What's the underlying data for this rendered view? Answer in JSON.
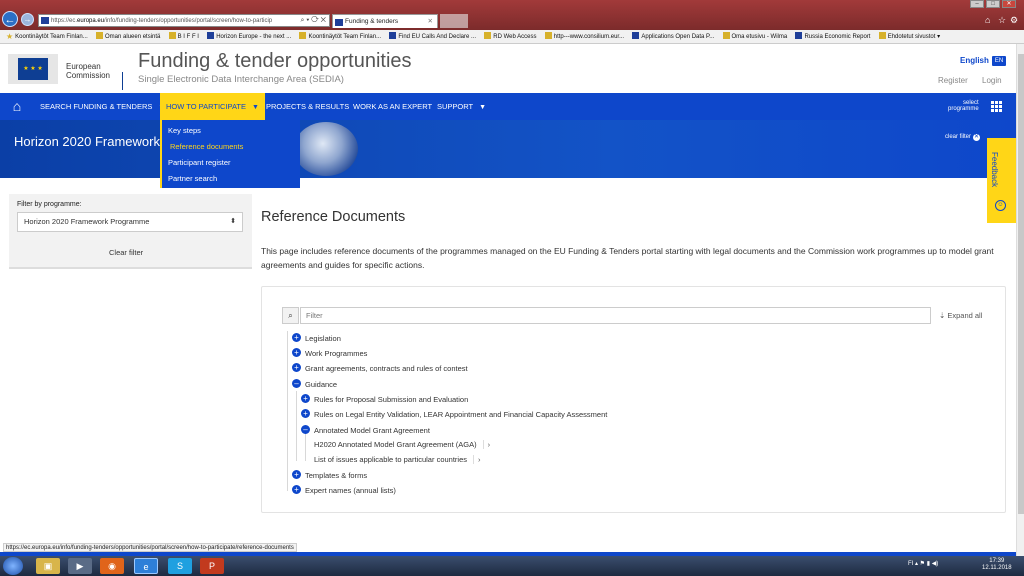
{
  "browser": {
    "url_prefix": "https://ec.",
    "url_domain": "europa.eu",
    "url_path": "/info/funding-tenders/opportunities/portal/screen/how-to-particip",
    "url_controls": "⌕ ▾ ⟳ ✕",
    "tab_title": "Funding & tenders",
    "tab_close": "✕",
    "back_icon": "back-arrow-icon",
    "forward_icon": "forward-arrow-icon",
    "window_controls": [
      "–",
      "□",
      "✕"
    ],
    "chrome_icons": [
      "⌂",
      "☆",
      "⚙",
      "☺"
    ]
  },
  "bookmarks": [
    {
      "label": "Koontinäytöt Team Finlan...",
      "icon": "folder"
    },
    {
      "label": "Oman alueen etsintä",
      "icon": "page"
    },
    {
      "label": "B I F F I",
      "icon": "page"
    },
    {
      "label": "Horizon Europe - the next ...",
      "icon": "eu"
    },
    {
      "label": "Koontinäytöt Team Finlan...",
      "icon": "folder"
    },
    {
      "label": "Find EU Calls And Declare ...",
      "icon": "eu"
    },
    {
      "label": "RD Web Access",
      "icon": "page"
    },
    {
      "label": "http---www.consilium.eur...",
      "icon": "page"
    },
    {
      "label": "Applications  Open Data P...",
      "icon": "page"
    },
    {
      "label": "Oma etusivu - Wilma",
      "icon": "page"
    },
    {
      "label": "Russia Economic Report",
      "icon": "page"
    },
    {
      "label": "Ehdotetut sivustot ▾",
      "icon": "page"
    }
  ],
  "header": {
    "logo_line1": "European",
    "logo_line2": "Commission",
    "title": "Funding & tender opportunities",
    "subtitle": "Single Electronic Data Interchange Area (SEDIA)",
    "language": "English",
    "language_code": "EN",
    "register": "Register",
    "login": "Login"
  },
  "nav": {
    "items": [
      {
        "label": "SEARCH FUNDING & TENDERS",
        "has_caret": true
      },
      {
        "label": "HOW TO PARTICIPATE",
        "has_caret": true,
        "active": true
      },
      {
        "label": "PROJECTS & RESULTS",
        "has_caret": false
      },
      {
        "label": "WORK AS AN EXPERT",
        "has_caret": false
      },
      {
        "label": "SUPPORT",
        "has_caret": true
      }
    ],
    "select_programme_line1": "select",
    "select_programme_line2": "programme",
    "caret": "▼"
  },
  "dropdown": {
    "items": [
      "Key steps",
      "Reference documents",
      "Participant register",
      "Partner search"
    ],
    "selected": "Reference documents"
  },
  "hero": {
    "title": "Horizon 2020 Framework",
    "clear_filter": "clear filter",
    "clear_icon": "✕"
  },
  "feedback": {
    "label": "Feedback",
    "icon": "☺"
  },
  "filter": {
    "label": "Filter by programme:",
    "selected_value": "Horizon 2020 Framework Programme",
    "select_arrow": "⬍",
    "clear_button": "Clear filter"
  },
  "content": {
    "title": "Reference Documents",
    "intro": "This page includes reference documents of the programmes managed on the EU Funding & Tenders portal starting with legal documents and the Commission work programmes up to model grant agreements and guides for specific actions.",
    "search_placeholder": "Filter",
    "search_icon": "🔍",
    "expand_all": "⇣ Expand all",
    "tree": [
      {
        "label": "Legislation",
        "state": "+"
      },
      {
        "label": "Work Programmes",
        "state": "+"
      },
      {
        "label": "Grant agreements, contracts and rules of contest",
        "state": "+"
      },
      {
        "label": "Guidance",
        "state": "–"
      },
      {
        "label": "Rules for Proposal Submission and Evaluation",
        "state": "+"
      },
      {
        "label": "Rules on Legal Entity Validation, LEAR Appointment and Financial Capacity Assessment",
        "state": "+"
      },
      {
        "label": "Annotated Model Grant Agreement",
        "state": "–"
      },
      {
        "label": "H2020 Annotated Model Grant Agreement (AGA)",
        "state": "›"
      },
      {
        "label": "List of issues applicable to particular countries",
        "state": "›"
      },
      {
        "label": "Templates & forms",
        "state": "+"
      },
      {
        "label": "Expert names (annual lists)",
        "state": "+"
      }
    ]
  },
  "status": {
    "hover_url": "https://ec.europa.eu/info/funding-tenders/opportunities/portal/screen/how-to-participate/reference-documents"
  },
  "taskbar": {
    "apps": [
      "▣",
      "▶",
      "◉",
      "e",
      "S",
      "P"
    ],
    "tray": "FI  ▴ ⚑ ▮ ◀)",
    "time": "17:39",
    "date": "12.11.2018"
  }
}
